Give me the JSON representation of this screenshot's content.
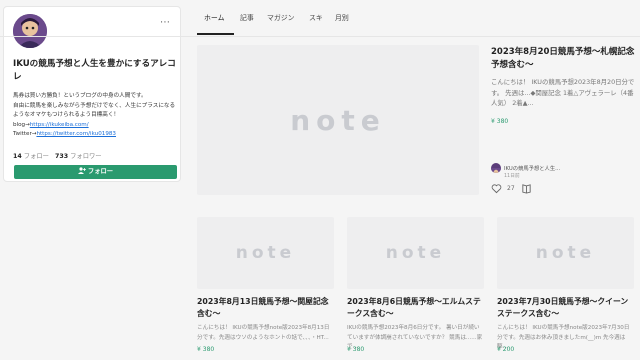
{
  "profile": {
    "name": "IKUの競馬予想と人生を豊かにするアレコレ",
    "bio_line1": "馬券は買い方勝負！というブログの中身の人間です。",
    "bio_line2": "自由に競馬を楽しみながら予想だけでなく、人生にプラスになるようなオマケもつけられるよう目標高く！",
    "blog_prefix": "blog→",
    "blog_url": "https://ikukeiba.com/",
    "twitter_prefix": "Twitter→",
    "twitter_url": "https://twitter.com/iku01983",
    "follow_count": "14",
    "follow_label": "フォロー",
    "follower_count": "733",
    "follower_label": "フォロワー",
    "follow_button": "フォロー",
    "more_icon": "⋯"
  },
  "tabs": [
    "ホーム",
    "記事",
    "マガジン",
    "スキ",
    "月別"
  ],
  "thumb_logo": "note",
  "featured": {
    "title": "2023年8月20日競馬予想～札幌記念予想含む～",
    "excerpt": "こんにちは！ IKUの競馬予想2023年8月20日分です。 先週は...◆関屋記念 1着△アヴェラーレ（4番人気） 2着▲...",
    "likes": "380",
    "author": "IKUの競馬予想と人生...",
    "time": "11日前",
    "heart_count": "27"
  },
  "articles": [
    {
      "title": "2023年8月13日競馬予想～関屋記念含む～",
      "excerpt": "こんにちは！ IKUの競馬予想note版2023年8月13日分です。先週はウソのようなホントの話で、、、・HT...",
      "likes": "380"
    },
    {
      "title": "2023年8月6日競馬予想～エルムステークス含む～",
      "excerpt": "IKUの競馬予想2023年8月6日分です。 暑い日が続いていますが体調崩されていないですか？ 競馬は......家で...",
      "likes": "380"
    },
    {
      "title": "2023年7月30日競馬予想～クイーンステークス含む～",
      "excerpt": "こんにちは！ IKUの競馬予想note版2023年7月30日分です。先週はお休み頂きましたm(__)m 先今週は駆...",
      "likes": "200"
    }
  ],
  "colors": {
    "accent": "#2a9a6f",
    "link": "#1a6ed8"
  }
}
